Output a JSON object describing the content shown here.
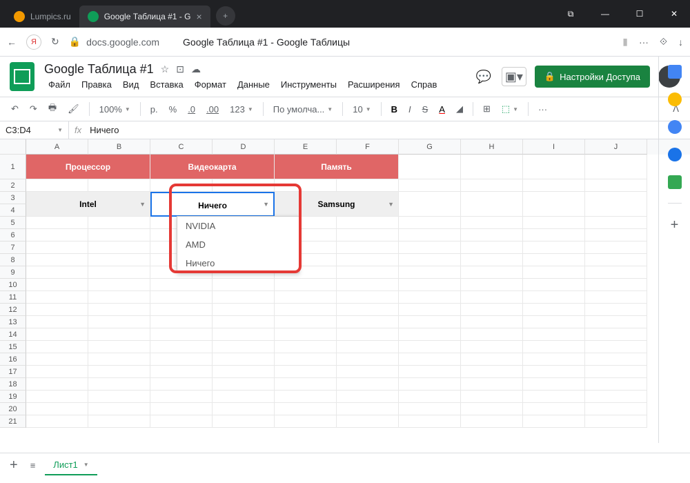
{
  "browser": {
    "tabs": [
      {
        "title": "Lumpics.ru",
        "active": false
      },
      {
        "title": "Google Таблица #1 - G",
        "active": true
      }
    ],
    "url_host": "docs.google.com",
    "page_title": "Google Таблица #1 - Google Таблицы"
  },
  "doc": {
    "title": "Google Таблица #1",
    "menus": [
      "Файл",
      "Правка",
      "Вид",
      "Вставка",
      "Формат",
      "Данные",
      "Инструменты",
      "Расширения",
      "Справ"
    ],
    "share_label": "Настройки Доступа"
  },
  "toolbar": {
    "zoom": "100%",
    "currency": "р.",
    "percent": "%",
    "dec_dec": ".0",
    "dec_inc": ".00",
    "format_num": "123",
    "font": "По умолча...",
    "font_size": "10",
    "bold": "B",
    "italic": "I",
    "strike": "S",
    "more": "···"
  },
  "namebox": {
    "ref": "C3:D4",
    "fx": "fx",
    "value": "Ничего"
  },
  "columns": [
    "A",
    "B",
    "C",
    "D",
    "E",
    "F",
    "G",
    "H",
    "I",
    "J"
  ],
  "headers": {
    "proc": "Процессор",
    "gpu": "Видеокарта",
    "mem": "Память"
  },
  "data": {
    "intel": "Intel",
    "nothing": "Ничего",
    "samsung": "Samsung"
  },
  "dropdown": {
    "opt1": "NVIDIA",
    "opt2": "AMD",
    "opt3": "Ничего"
  },
  "sheet_tab": "Лист1"
}
